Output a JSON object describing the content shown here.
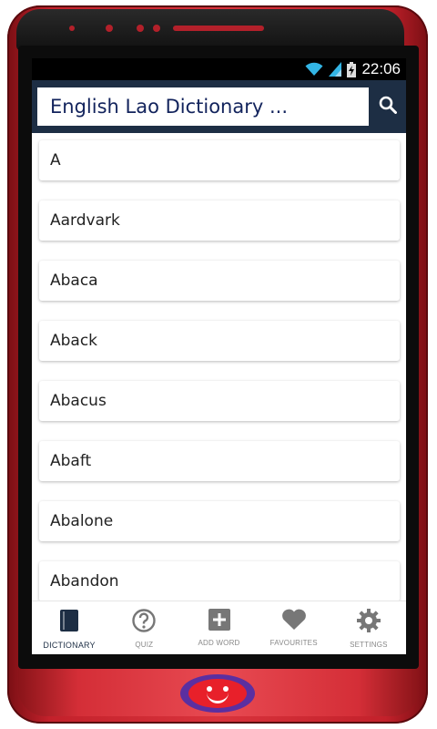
{
  "status_bar": {
    "time": "22:06"
  },
  "search": {
    "placeholder": "English Lao Dictionary ..."
  },
  "words": [
    "A",
    "Aardvark",
    "Abaca",
    "Aback",
    "Abacus",
    "Abaft",
    "Abalone",
    "Abandon"
  ],
  "nav": [
    {
      "label": "DICTIONARY",
      "icon": "book-icon",
      "active": true
    },
    {
      "label": "QUIZ",
      "icon": "help-circle-icon"
    },
    {
      "label": "ADD WORD",
      "icon": "add-box-icon"
    },
    {
      "label": "FAVOURITES",
      "icon": "heart-icon"
    },
    {
      "label": "SETTINGS",
      "icon": "gear-icon"
    }
  ],
  "colors": {
    "primary": "#1d2e44",
    "phone_frame": "#c3212b",
    "home_button": "#5b2fa0"
  }
}
